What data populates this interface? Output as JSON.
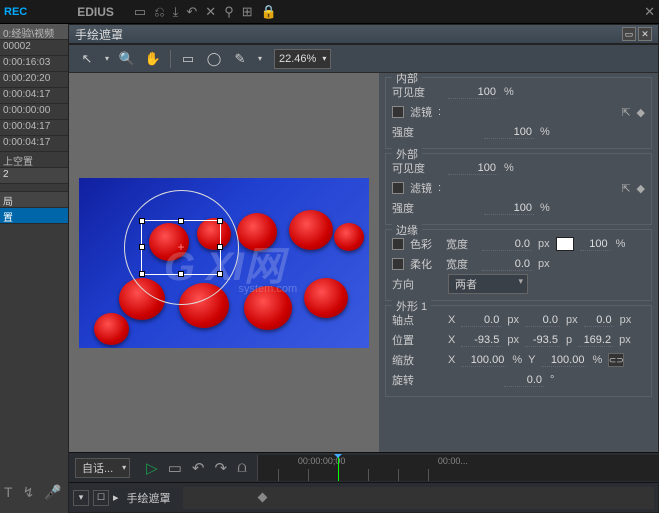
{
  "app": {
    "rec": "REC",
    "title": "EDIUS"
  },
  "panel": {
    "title": "手绘遮罩"
  },
  "left": {
    "rows": [
      "0:经验\\视频",
      "00002",
      "0:00:16:03",
      "0:00:20:20",
      "0:00:04:17",
      "0:00:00:00",
      "0:00:04:17",
      "0:00:04:17",
      "上空置"
    ],
    "count": "2",
    "group": "局",
    "sel": "置"
  },
  "toolbar": {
    "zoom": "22.46%"
  },
  "sections": {
    "inner": {
      "title": "内部",
      "visibility_lbl": "可见度",
      "visibility": "100",
      "pct": "%",
      "filter_lbl": "滤镜",
      "colon": ":",
      "intensity_lbl": "强度",
      "intensity": "100"
    },
    "outer": {
      "title": "外部",
      "visibility_lbl": "可见度",
      "visibility": "100",
      "pct": "%",
      "filter_lbl": "滤镜",
      "colon": ":",
      "intensity_lbl": "强度",
      "intensity": "100"
    },
    "edge": {
      "title": "边缘",
      "color_lbl": "色彩",
      "width_lbl": "宽度",
      "w1": "0.0",
      "px": "px",
      "soft_lbl": "柔化",
      "w2": "0.0",
      "pct100": "100",
      "pct": "%",
      "dir_lbl": "方向",
      "dir_val": "两者"
    },
    "shape": {
      "title": "外形 1",
      "anchor_lbl": "轴点",
      "x": "X",
      "y": "Y",
      "ax": "0.0",
      "ay": "0.0",
      "az": "0.0",
      "pos_lbl": "位置",
      "px1": "-93.5",
      "px2": "-93.5",
      "px3": "169.2",
      "scale_lbl": "缩放",
      "sx": "100.00",
      "sy": "100.00",
      "rot_lbl": "旋转",
      "rot": "0.0",
      "deg": "°",
      "px": "px",
      "pct": "%",
      "p": "p"
    }
  },
  "bottom": {
    "dd": "自话...",
    "track": "手绘遮罩",
    "time1": "00:00:00;00",
    "time2": "00:00..."
  },
  "chart_data": null
}
